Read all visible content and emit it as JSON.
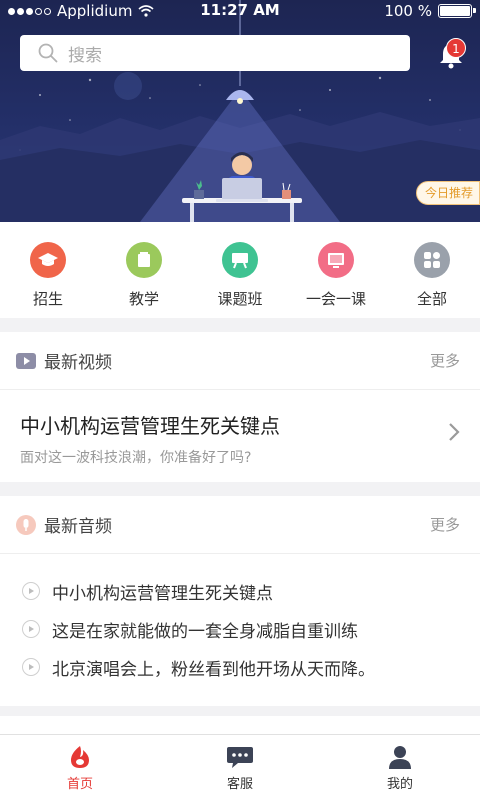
{
  "status_bar": {
    "carrier": "Applidium",
    "time": "11:27 AM",
    "battery": "100 %"
  },
  "search": {
    "placeholder": "搜索"
  },
  "notifications": {
    "badge_count": "1"
  },
  "banner": {
    "tag": "今日推荐"
  },
  "categories": [
    {
      "label": "招生",
      "icon": "graduation-cap-icon",
      "color": "#f0654a"
    },
    {
      "label": "教学",
      "icon": "book-icon",
      "color": "#9bc95c"
    },
    {
      "label": "课题班",
      "icon": "easel-icon",
      "color": "#3fc392"
    },
    {
      "label": "一会一课",
      "icon": "screen-icon",
      "color": "#f26d86"
    },
    {
      "label": "全部",
      "icon": "grid-icon",
      "color": "#9aa1ab"
    }
  ],
  "video_section": {
    "title": "最新视频",
    "more": "更多",
    "item": {
      "title": "中小机构运营管理生死关键点",
      "subtitle": "面对这一波科技浪潮，你准备好了吗?"
    }
  },
  "audio_section": {
    "title": "最新音频",
    "more": "更多",
    "items": [
      {
        "title": "中小机构运营管理生死关键点"
      },
      {
        "title": "这是在家就能做的一套全身减脂自重训练"
      },
      {
        "title": "北京演唱会上，粉丝看到他开场从天而降。"
      }
    ]
  },
  "tabbar": {
    "items": [
      {
        "label": "首页",
        "active": true
      },
      {
        "label": "客服",
        "active": false
      },
      {
        "label": "我的",
        "active": false
      }
    ]
  },
  "colors": {
    "accent": "#e53935",
    "hero": "#232f68",
    "tag": "#e49b2a"
  }
}
